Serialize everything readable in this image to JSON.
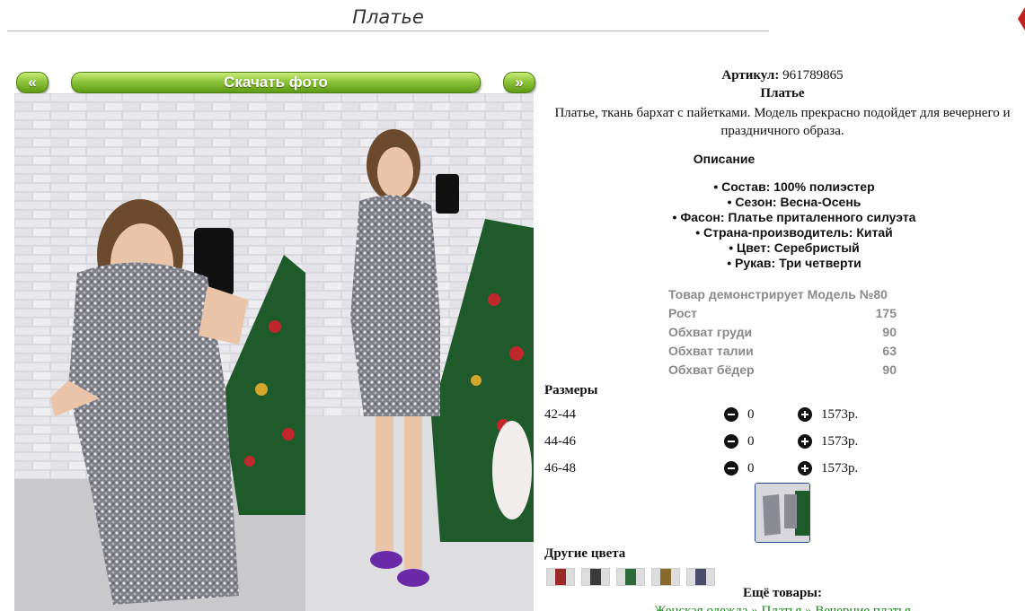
{
  "page": {
    "title": "Платье"
  },
  "gallery": {
    "prev_label": "«",
    "next_label": "»",
    "download_label": "Скачать фото"
  },
  "product": {
    "article_label": "Артикул:",
    "article_value": "961789865",
    "name": "Платье",
    "description": "Платье, ткань бархат с пайетками. Модель прекрасно подойдет для вечернего и праздничного образа.",
    "description_heading": "Описание",
    "properties": [
      "Состав: 100% полиэстер",
      "Сезон: Весна-Осень",
      "Фасон: Платье приталенного силуэта",
      "Страна-производитель: Китай",
      "Цвет: Серебристый",
      "Рукав: Три четверти"
    ]
  },
  "model": {
    "heading": "Товар демонстрирует Модель №80",
    "rows": [
      {
        "label": "Рост",
        "value": "175"
      },
      {
        "label": "Обхват груди",
        "value": "90"
      },
      {
        "label": "Обхват талии",
        "value": "63"
      },
      {
        "label": "Обхват бёдер",
        "value": "90"
      }
    ]
  },
  "sizes": {
    "heading": "Размеры",
    "rows": [
      {
        "size": "42-44",
        "qty": "0",
        "price": "1573р."
      },
      {
        "size": "44-46",
        "qty": "0",
        "price": "1573р."
      },
      {
        "size": "46-48",
        "qty": "0",
        "price": "1573р."
      }
    ]
  },
  "other_colors": {
    "heading": "Другие цвета",
    "swatches": [
      "#9a2a2a",
      "#3a3a3a",
      "#2f6b3a",
      "#8a6a2a",
      "#4a4a6a"
    ]
  },
  "more": {
    "heading": "Ещё товары:",
    "links": [
      "Женская одежда",
      "Платья",
      "Вечерние платья"
    ]
  },
  "colors": {
    "button_green": "#6aa81e",
    "link_green": "#1a8a1a",
    "thumb_border": "#2a4d8a"
  }
}
